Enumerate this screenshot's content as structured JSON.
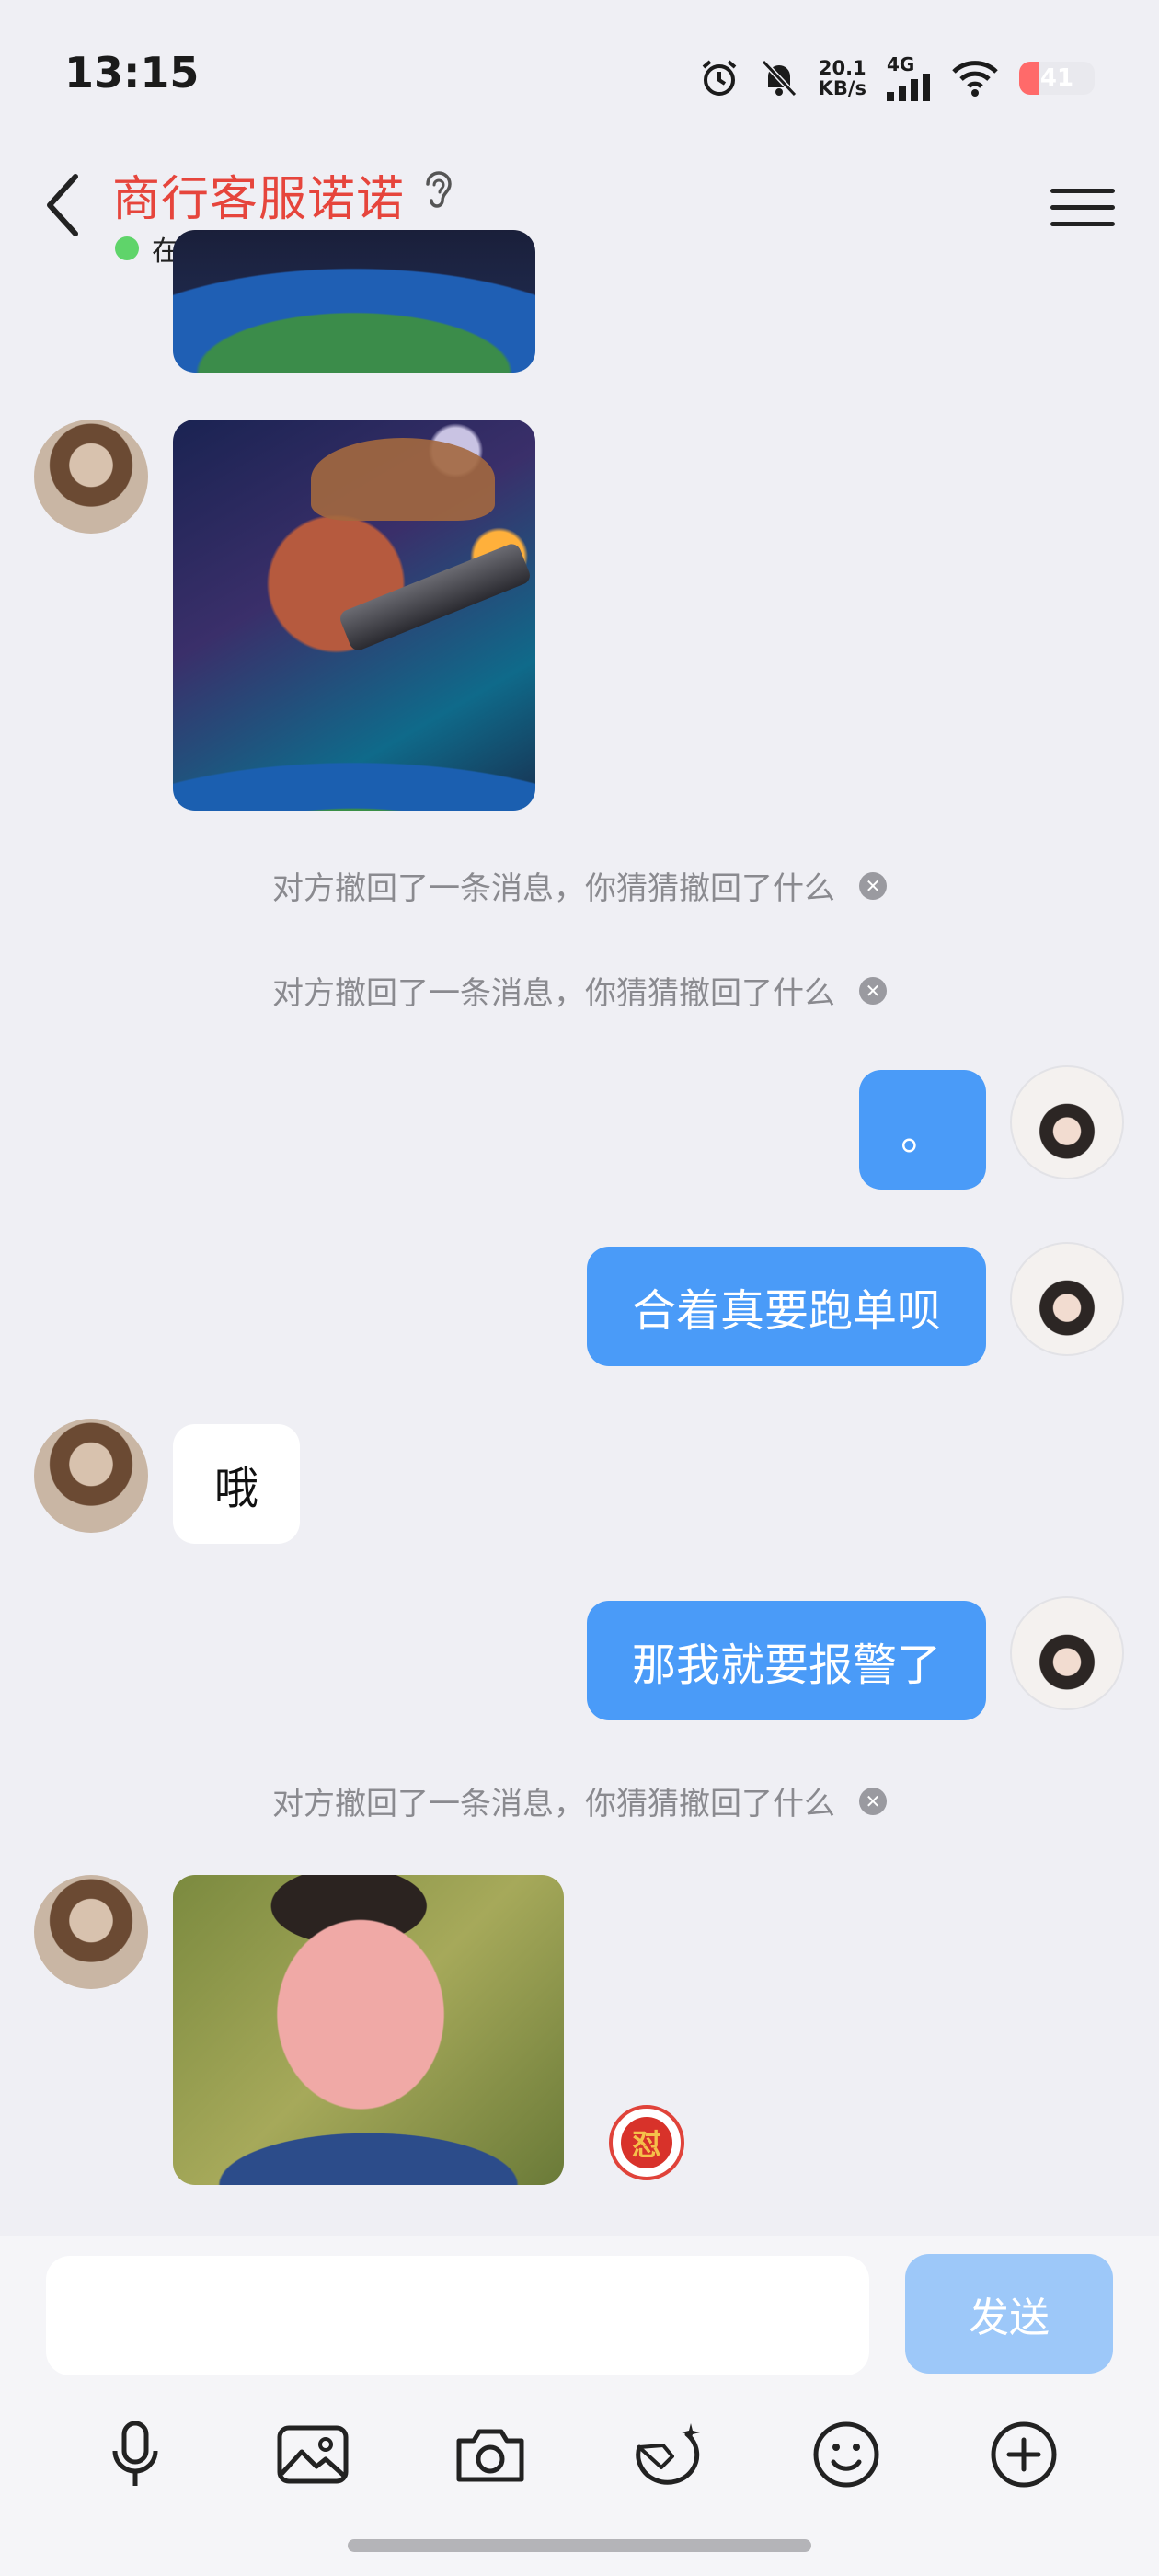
{
  "status_bar": {
    "time": "13:15",
    "net_speed_value": "20.1",
    "net_speed_unit": "KB/s",
    "network_type": "4G",
    "battery_level": "41",
    "icons": [
      "alarm-icon",
      "mute-bell-icon",
      "signal-icon",
      "wifi-icon",
      "battery-icon"
    ]
  },
  "header": {
    "title": "商行客服诺诺",
    "presence": "在线",
    "title_color": "#e6453c",
    "presence_color": "#5fd46a"
  },
  "recall_text": "对方撤回了一条消息，你猜猜撤回了什么",
  "messages": [
    {
      "type": "image",
      "from": "them",
      "content": "earth-image"
    },
    {
      "type": "image",
      "from": "them",
      "content": "moose-with-cannon-image"
    },
    {
      "type": "recall",
      "text": "对方撤回了一条消息，你猜猜撤回了什么"
    },
    {
      "type": "recall",
      "text": "对方撤回了一条消息，你猜猜撤回了什么"
    },
    {
      "type": "text",
      "from": "me",
      "text": "。"
    },
    {
      "type": "text",
      "from": "me",
      "text": "合着真要跑单呗"
    },
    {
      "type": "text",
      "from": "them",
      "text": "哦"
    },
    {
      "type": "text",
      "from": "me",
      "text": "那我就要报警了"
    },
    {
      "type": "recall",
      "text": "对方撤回了一条消息，你猜猜撤回了什么"
    },
    {
      "type": "image",
      "from": "them",
      "content": "face-meme-image",
      "reaction": "怼"
    }
  ],
  "input": {
    "value": "",
    "placeholder": "",
    "send_label": "发送"
  },
  "toolbar": [
    "microphone-icon",
    "gallery-icon",
    "camera-icon",
    "sticker-icon",
    "emoji-icon",
    "plus-icon"
  ],
  "colors": {
    "outgoing_bubble": "#4a9bf8",
    "incoming_bubble": "#ffffff",
    "send_button_disabled": "#9dc8f9",
    "background": "#efeff4"
  }
}
